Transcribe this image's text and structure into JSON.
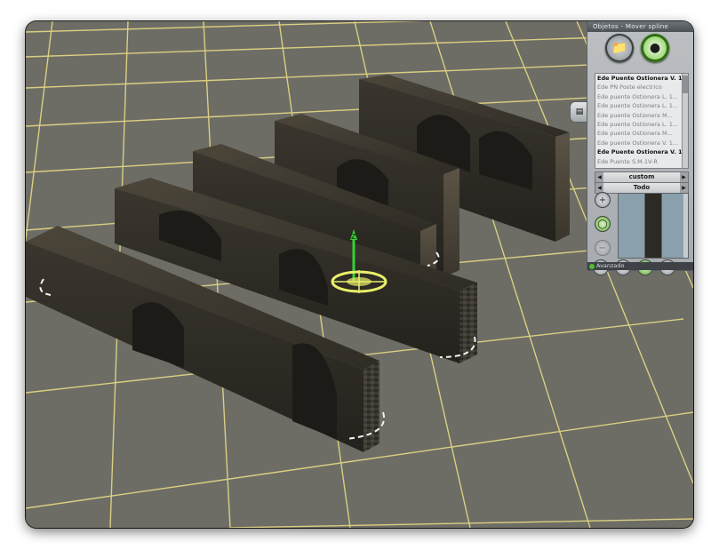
{
  "panel": {
    "title": "Objetos - Mover spline",
    "mode_buttons": [
      {
        "icon": "folder-object-icon"
      },
      {
        "icon": "spline-node-icon"
      }
    ],
    "object_list": [
      {
        "label": "Ede Puente Ostionera V. 1 w...",
        "selected": true
      },
      {
        "label": "Ede PN Poste electrico",
        "selected": false
      },
      {
        "label": "Ede puente Ostionera L. 1...",
        "selected": false
      },
      {
        "label": "Ede puente Ostionera L. 1...",
        "selected": false
      },
      {
        "label": "Ede puente Ostionera M...",
        "selected": false
      },
      {
        "label": "Ede puente Ostionera L. 1...",
        "selected": false
      },
      {
        "label": "Ede puente Ostionera M...",
        "selected": false
      },
      {
        "label": "Ede puente Ostionera V. 1...",
        "selected": false
      },
      {
        "label": "Ede Puente Ostionera V. 1...",
        "selected": true
      },
      {
        "label": "Ede Puente S.M.1V-R",
        "selected": false
      }
    ],
    "filter_1": "custom",
    "filter_2": "Todo",
    "footer": "Avanzado"
  },
  "viewport": {
    "gizmo_axis": "z"
  },
  "colors": {
    "grid_line": "#e7d984",
    "ground": "#6d6d66",
    "selection_ring": "#f4f4f4",
    "gizmo": "#e9f06a",
    "axis_z": "#33d133"
  }
}
